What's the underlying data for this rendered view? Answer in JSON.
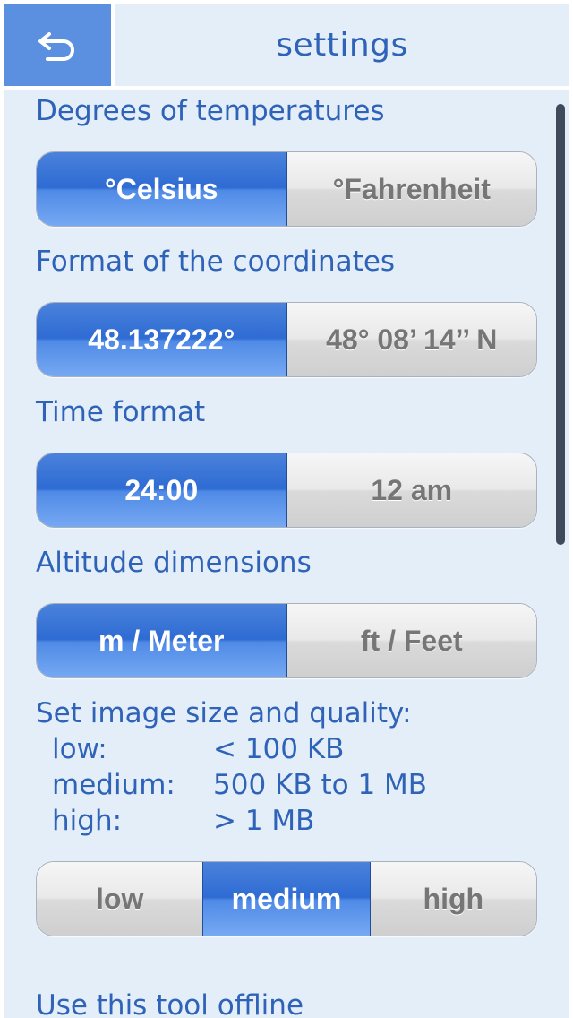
{
  "header": {
    "title": "settings",
    "back_icon": "back-arrow-icon"
  },
  "temperature": {
    "label": "Degrees of temperatures",
    "options": [
      "°Celsius",
      "°Fahrenheit"
    ],
    "selected": "°Celsius"
  },
  "coordinates": {
    "label": "Format of the coordinates",
    "options": [
      "48.137222°",
      "48° 08’ 14’’ N"
    ],
    "selected": "48.137222°"
  },
  "time": {
    "label": "Time format",
    "options": [
      "24:00",
      "12 am"
    ],
    "selected": "24:00"
  },
  "altitude": {
    "label": "Altitude dimensions",
    "options": [
      "m / Meter",
      "ft / Feet"
    ],
    "selected": "m / Meter"
  },
  "image_quality": {
    "label": "Set image size and quality:",
    "rows": [
      {
        "key": "low:",
        "value": "< 100 KB"
      },
      {
        "key": "medium:",
        "value": "500 KB to 1 MB"
      },
      {
        "key": "high:",
        "value": "> 1 MB"
      }
    ],
    "options": [
      "low",
      "medium",
      "high"
    ],
    "selected": "medium"
  },
  "offline": {
    "label": "Use this tool offline"
  },
  "colors": {
    "accent": "#2f63b8",
    "selected_segment": "#3a76d9",
    "unselected_segment": "#e2e2e2",
    "background": "#e4eef9"
  }
}
